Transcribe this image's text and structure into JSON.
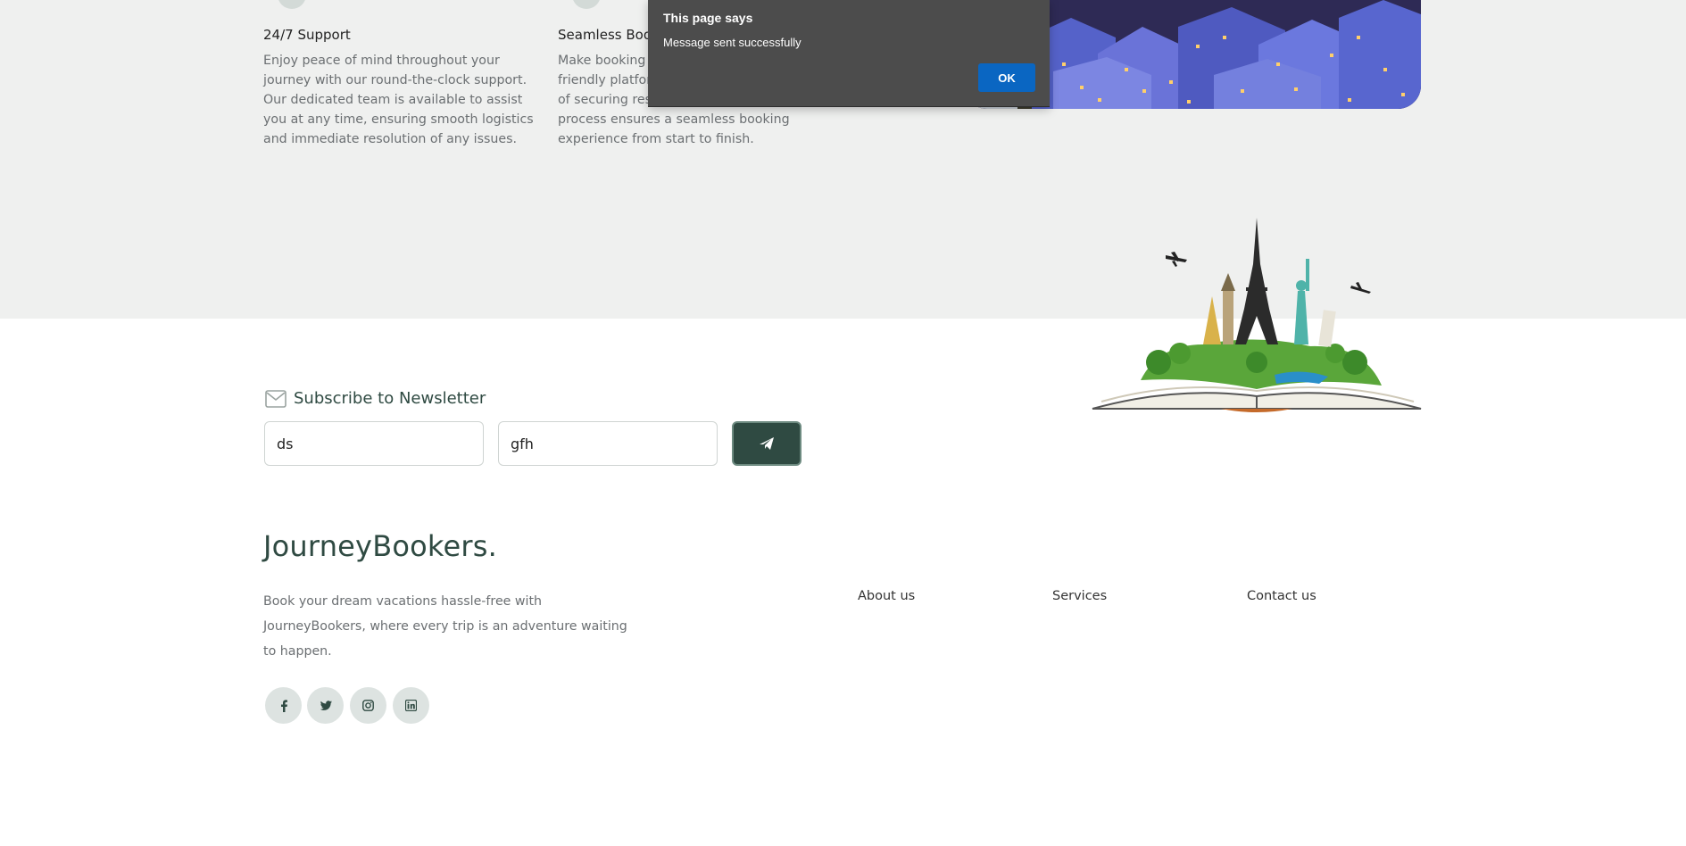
{
  "features": [
    {
      "title": "24/7 Support",
      "text": "Enjoy peace of mind throughout your journey with our round-the-clock support. Our dedicated team is available to assist you at any time, ensuring smooth logistics and immediate resolution of any issues."
    },
    {
      "title": "Seamless Booking",
      "text": "Make booking hassle-free with our user-friendly platform, simplifying the process of securing reservations. Our streamlined process ensures a seamless booking experience from start to finish."
    }
  ],
  "dialog": {
    "title": "This page says",
    "message": "Message sent successfully",
    "ok_label": "OK"
  },
  "newsletter": {
    "label": "Subscribe to Newsletter",
    "field1_value": "ds",
    "field2_value": "gfh"
  },
  "footer": {
    "brand": "JourneyBookers.",
    "description": "Book your dream vacations hassle-free with JourneyBookers, where every trip is an adventure waiting to happen.",
    "links": [
      "About us",
      "Services",
      "Contact us"
    ],
    "social": [
      "facebook-icon",
      "twitter-icon",
      "instagram-icon",
      "linkedin-icon"
    ]
  },
  "colors": {
    "brand": "#2f4a42",
    "band": "#eff0ef",
    "dialog": "#4c4c4c",
    "ok_button": "#0a66c2"
  }
}
